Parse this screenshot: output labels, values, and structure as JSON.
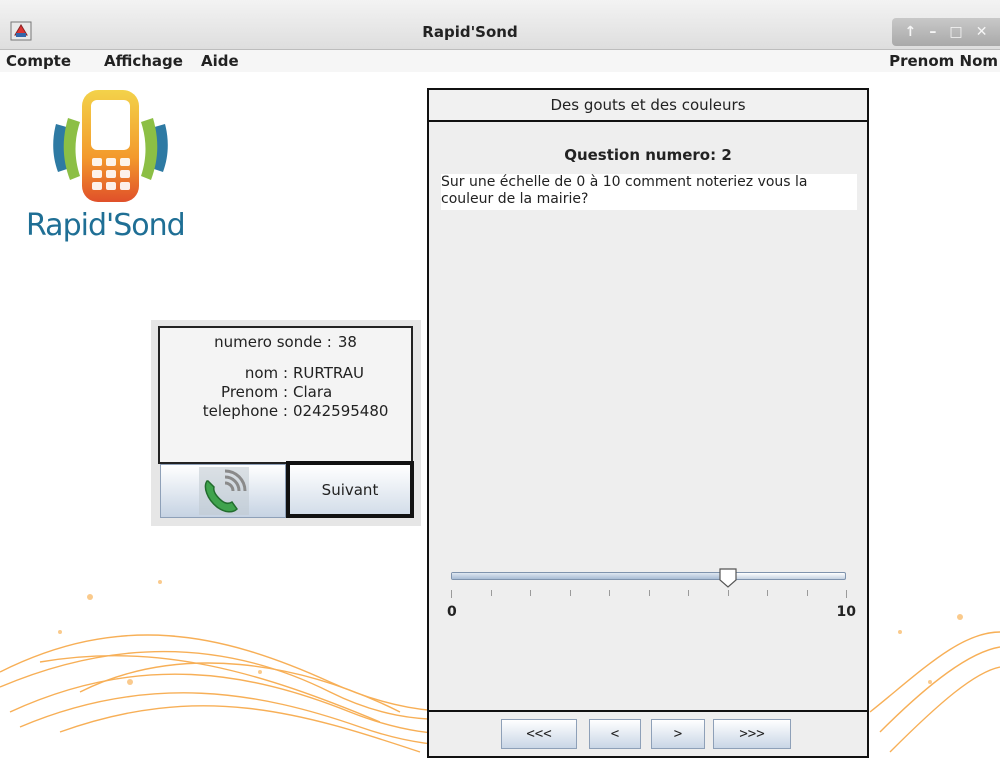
{
  "window": {
    "title": "Rapid'Sond",
    "controls": [
      "↑",
      "–",
      "□",
      "✕"
    ]
  },
  "menu": {
    "items": [
      "Compte",
      "Affichage",
      "Aide"
    ],
    "user": "Prenom Nom"
  },
  "logo": {
    "text": "Rapid'Sond"
  },
  "contact": {
    "sonde_label": "numero sonde :",
    "sonde_number": "38",
    "fields": [
      {
        "label": "nom :",
        "value": "RURTRAU"
      },
      {
        "label": "Prenom :",
        "value": "Clara"
      },
      {
        "label": "telephone :",
        "value": "0242595480"
      }
    ],
    "call_icon": "phone-icon",
    "next_label": "Suivant"
  },
  "survey": {
    "title": "Des gouts et des couleurs",
    "question_number": "Question numero: 2",
    "question_text": "Sur une échelle de 0 à 10 comment noteriez vous la couleur de la mairie?",
    "slider": {
      "min": "0",
      "max": "10",
      "value": 7
    },
    "nav": [
      "<<<",
      "<",
      ">",
      ">>>"
    ]
  },
  "colors": {
    "logo_blue": "#1f6f95",
    "accent_orange": "#f39a2c",
    "frame": "#111111"
  }
}
